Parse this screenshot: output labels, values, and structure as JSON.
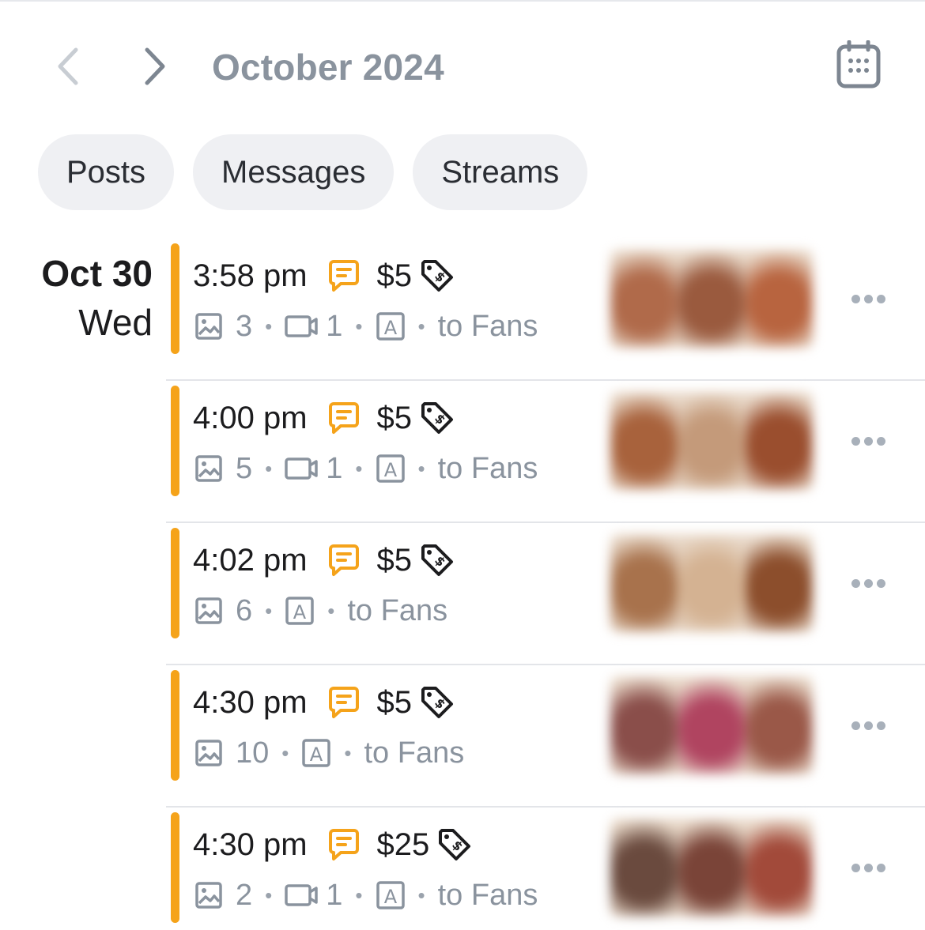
{
  "header": {
    "month_title": "October 2024",
    "prev_icon": "chevron-left-icon",
    "next_icon": "chevron-right-icon",
    "calendar_icon": "calendar-icon"
  },
  "tabs": [
    {
      "label": "Posts"
    },
    {
      "label": "Messages"
    },
    {
      "label": "Streams"
    }
  ],
  "day": {
    "date": "Oct 30",
    "weekday": "Wed"
  },
  "colors": {
    "accent": "#f5a31a",
    "muted": "#8a939e",
    "chip_bg": "#eff0f3"
  },
  "entries": [
    {
      "time": "3:58 pm",
      "price": "$5",
      "images": "3",
      "videos": "1",
      "audience": "to Fans",
      "thumb_palette": [
        "#b06a4a",
        "#9a5a3e",
        "#b8643f"
      ]
    },
    {
      "time": "4:00 pm",
      "price": "$5",
      "images": "5",
      "videos": "1",
      "audience": "to Fans",
      "thumb_palette": [
        "#a8623c",
        "#c49a7a",
        "#9a4e2e"
      ]
    },
    {
      "time": "4:02 pm",
      "price": "$5",
      "images": "6",
      "audience": "to Fans",
      "thumb_palette": [
        "#a8724c",
        "#d4b292",
        "#8c4e2c"
      ]
    },
    {
      "time": "4:30 pm",
      "price": "$5",
      "images": "10",
      "audience": "to Fans",
      "thumb_palette": [
        "#8a4e4a",
        "#b04460",
        "#9a5848"
      ]
    },
    {
      "time": "4:30 pm",
      "price": "$25",
      "images": "2",
      "videos": "1",
      "audience": "to Fans",
      "thumb_palette": [
        "#6a4a3e",
        "#7a4438",
        "#a24a3a"
      ]
    }
  ]
}
